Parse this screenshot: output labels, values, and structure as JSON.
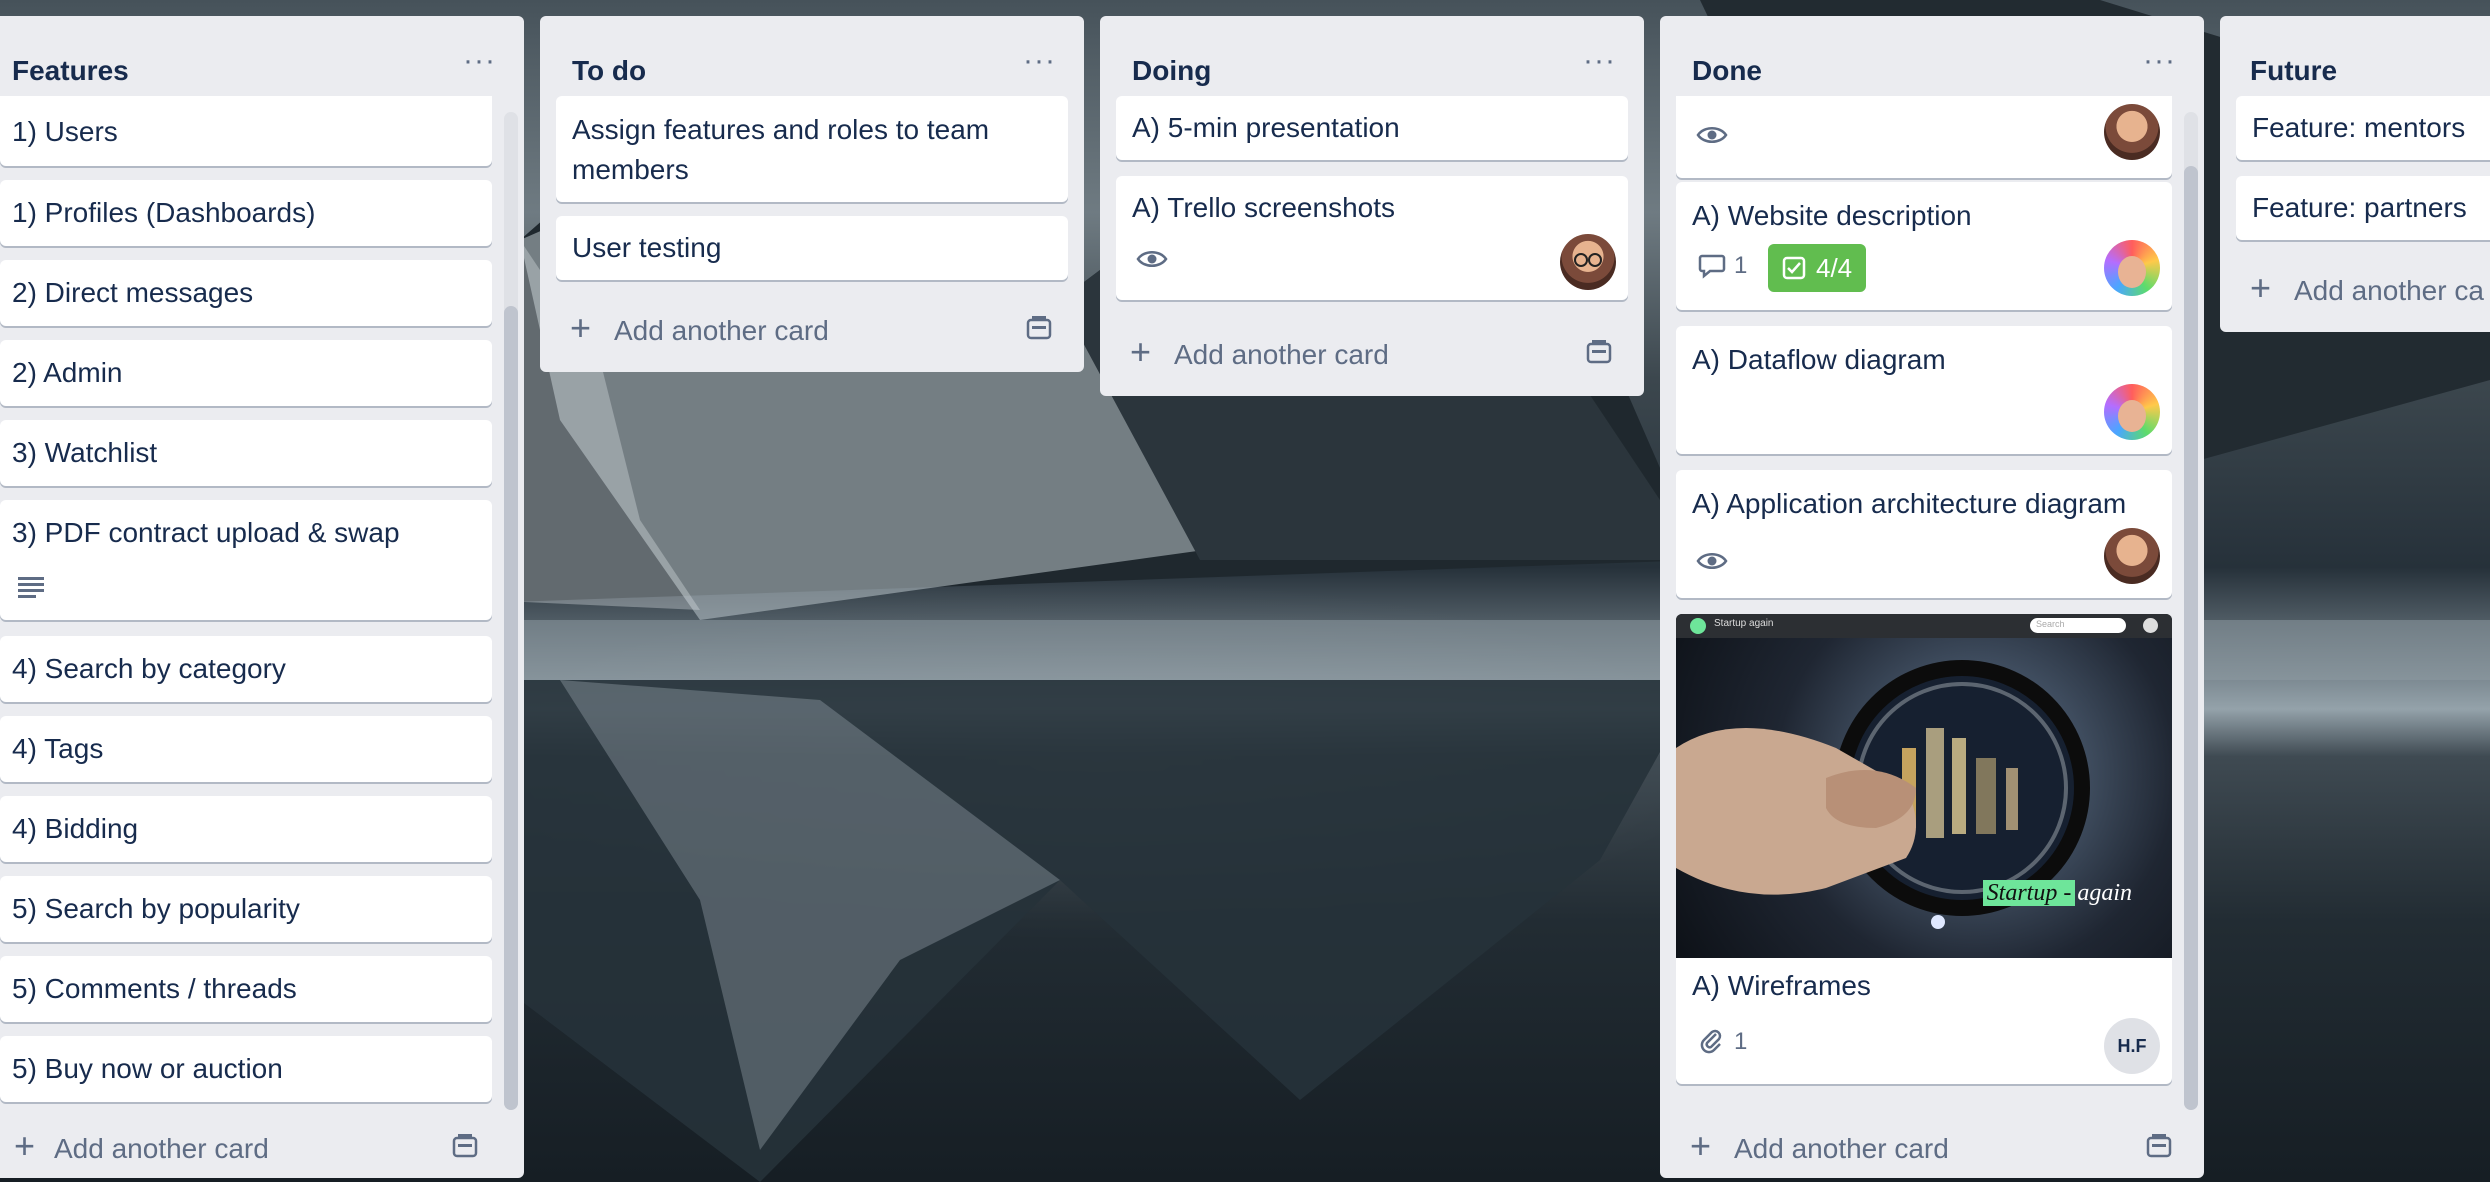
{
  "board": {
    "lists": [
      {
        "title": "Features",
        "menu": "···",
        "cards": [
          {
            "title": "1) Users"
          },
          {
            "title": "1) Profiles (Dashboards)"
          },
          {
            "title": "2) Direct messages"
          },
          {
            "title": "2) Admin"
          },
          {
            "title": "3) Watchlist"
          },
          {
            "title": "3) PDF contract upload & swap",
            "icon": "description-icon"
          },
          {
            "title": "4) Search by category"
          },
          {
            "title": "4) Tags"
          },
          {
            "title": "4) Bidding"
          },
          {
            "title": "5) Search by popularity"
          },
          {
            "title": "5) Comments / threads"
          },
          {
            "title": "5) Buy now or auction"
          }
        ],
        "add_card": "Add another card"
      },
      {
        "title": "To do",
        "menu": "···",
        "cards": [
          {
            "title": "Assign features and roles to team members"
          },
          {
            "title": "User testing"
          }
        ],
        "add_card": "Add another card"
      },
      {
        "title": "Doing",
        "menu": "···",
        "cards": [
          {
            "title": "A) 5-min presentation"
          },
          {
            "title": "A) Trello screenshots",
            "icon": "eye-icon"
          }
        ],
        "add_card": "Add another card"
      },
      {
        "title": "Done",
        "menu": "···",
        "cards": [
          {
            "title": "",
            "icon": "eye-icon"
          },
          {
            "title": "A) Website description",
            "comments": "1",
            "checklist": "4/4"
          },
          {
            "title": "A) Dataflow diagram"
          },
          {
            "title": "A) Application architecture diagram",
            "icon": "eye-icon"
          },
          {
            "title": "A) Wireframes",
            "attachments": "1",
            "member_initials": "H.F",
            "cover": {
              "site_name": "Startup again",
              "search_placeholder": "Search",
              "logo_text_highlight": "Startup -",
              "logo_text_rest": "again"
            }
          }
        ],
        "add_card": "Add another card"
      },
      {
        "title": "Future",
        "menu": "···",
        "cards": [
          {
            "title": "Feature: mentors"
          },
          {
            "title": "Feature: partners"
          }
        ],
        "add_card": "Add another ca"
      }
    ]
  },
  "colors": {
    "list_bg": "#ebecf0",
    "card_bg": "#ffffff",
    "text": "#172b4d",
    "muted": "#5e6c84",
    "checklist_complete": "#61bd4f",
    "cover_highlight": "#6ee59a"
  }
}
